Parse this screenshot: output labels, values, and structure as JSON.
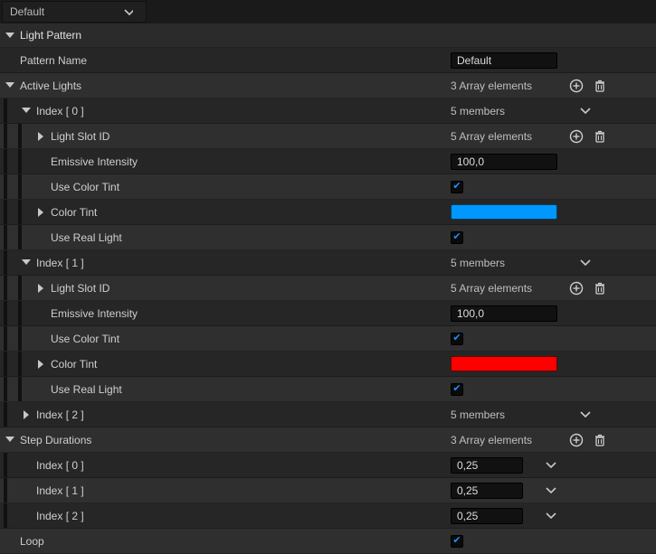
{
  "topDropdown": "Default",
  "section": "Light Pattern",
  "patternName": {
    "label": "Pattern Name",
    "value": "Default"
  },
  "activeLights": {
    "label": "Active Lights",
    "summary": "3 Array elements",
    "items": [
      {
        "indexLabel": "Index [ 0 ]",
        "membersSummary": "5 members",
        "expanded": true,
        "lightSlotId": {
          "label": "Light Slot ID",
          "summary": "5 Array elements"
        },
        "emissiveIntensity": {
          "label": "Emissive Intensity",
          "value": "100,0"
        },
        "useColorTint": {
          "label": "Use Color Tint",
          "checked": true
        },
        "colorTint": {
          "label": "Color Tint",
          "color": "#0097ff"
        },
        "useRealLight": {
          "label": "Use Real Light",
          "checked": true
        }
      },
      {
        "indexLabel": "Index [ 1 ]",
        "membersSummary": "5 members",
        "expanded": true,
        "lightSlotId": {
          "label": "Light Slot ID",
          "summary": "5 Array elements"
        },
        "emissiveIntensity": {
          "label": "Emissive Intensity",
          "value": "100,0"
        },
        "useColorTint": {
          "label": "Use Color Tint",
          "checked": true
        },
        "colorTint": {
          "label": "Color Tint",
          "color": "#ff0000"
        },
        "useRealLight": {
          "label": "Use Real Light",
          "checked": true
        }
      },
      {
        "indexLabel": "Index [ 2 ]",
        "membersSummary": "5 members",
        "expanded": false
      }
    ]
  },
  "stepDurations": {
    "label": "Step Durations",
    "summary": "3 Array elements",
    "items": [
      {
        "indexLabel": "Index [ 0 ]",
        "value": "0,25"
      },
      {
        "indexLabel": "Index [ 1 ]",
        "value": "0,25"
      },
      {
        "indexLabel": "Index [ 2 ]",
        "value": "0,25"
      }
    ]
  },
  "loop": {
    "label": "Loop",
    "checked": true
  }
}
